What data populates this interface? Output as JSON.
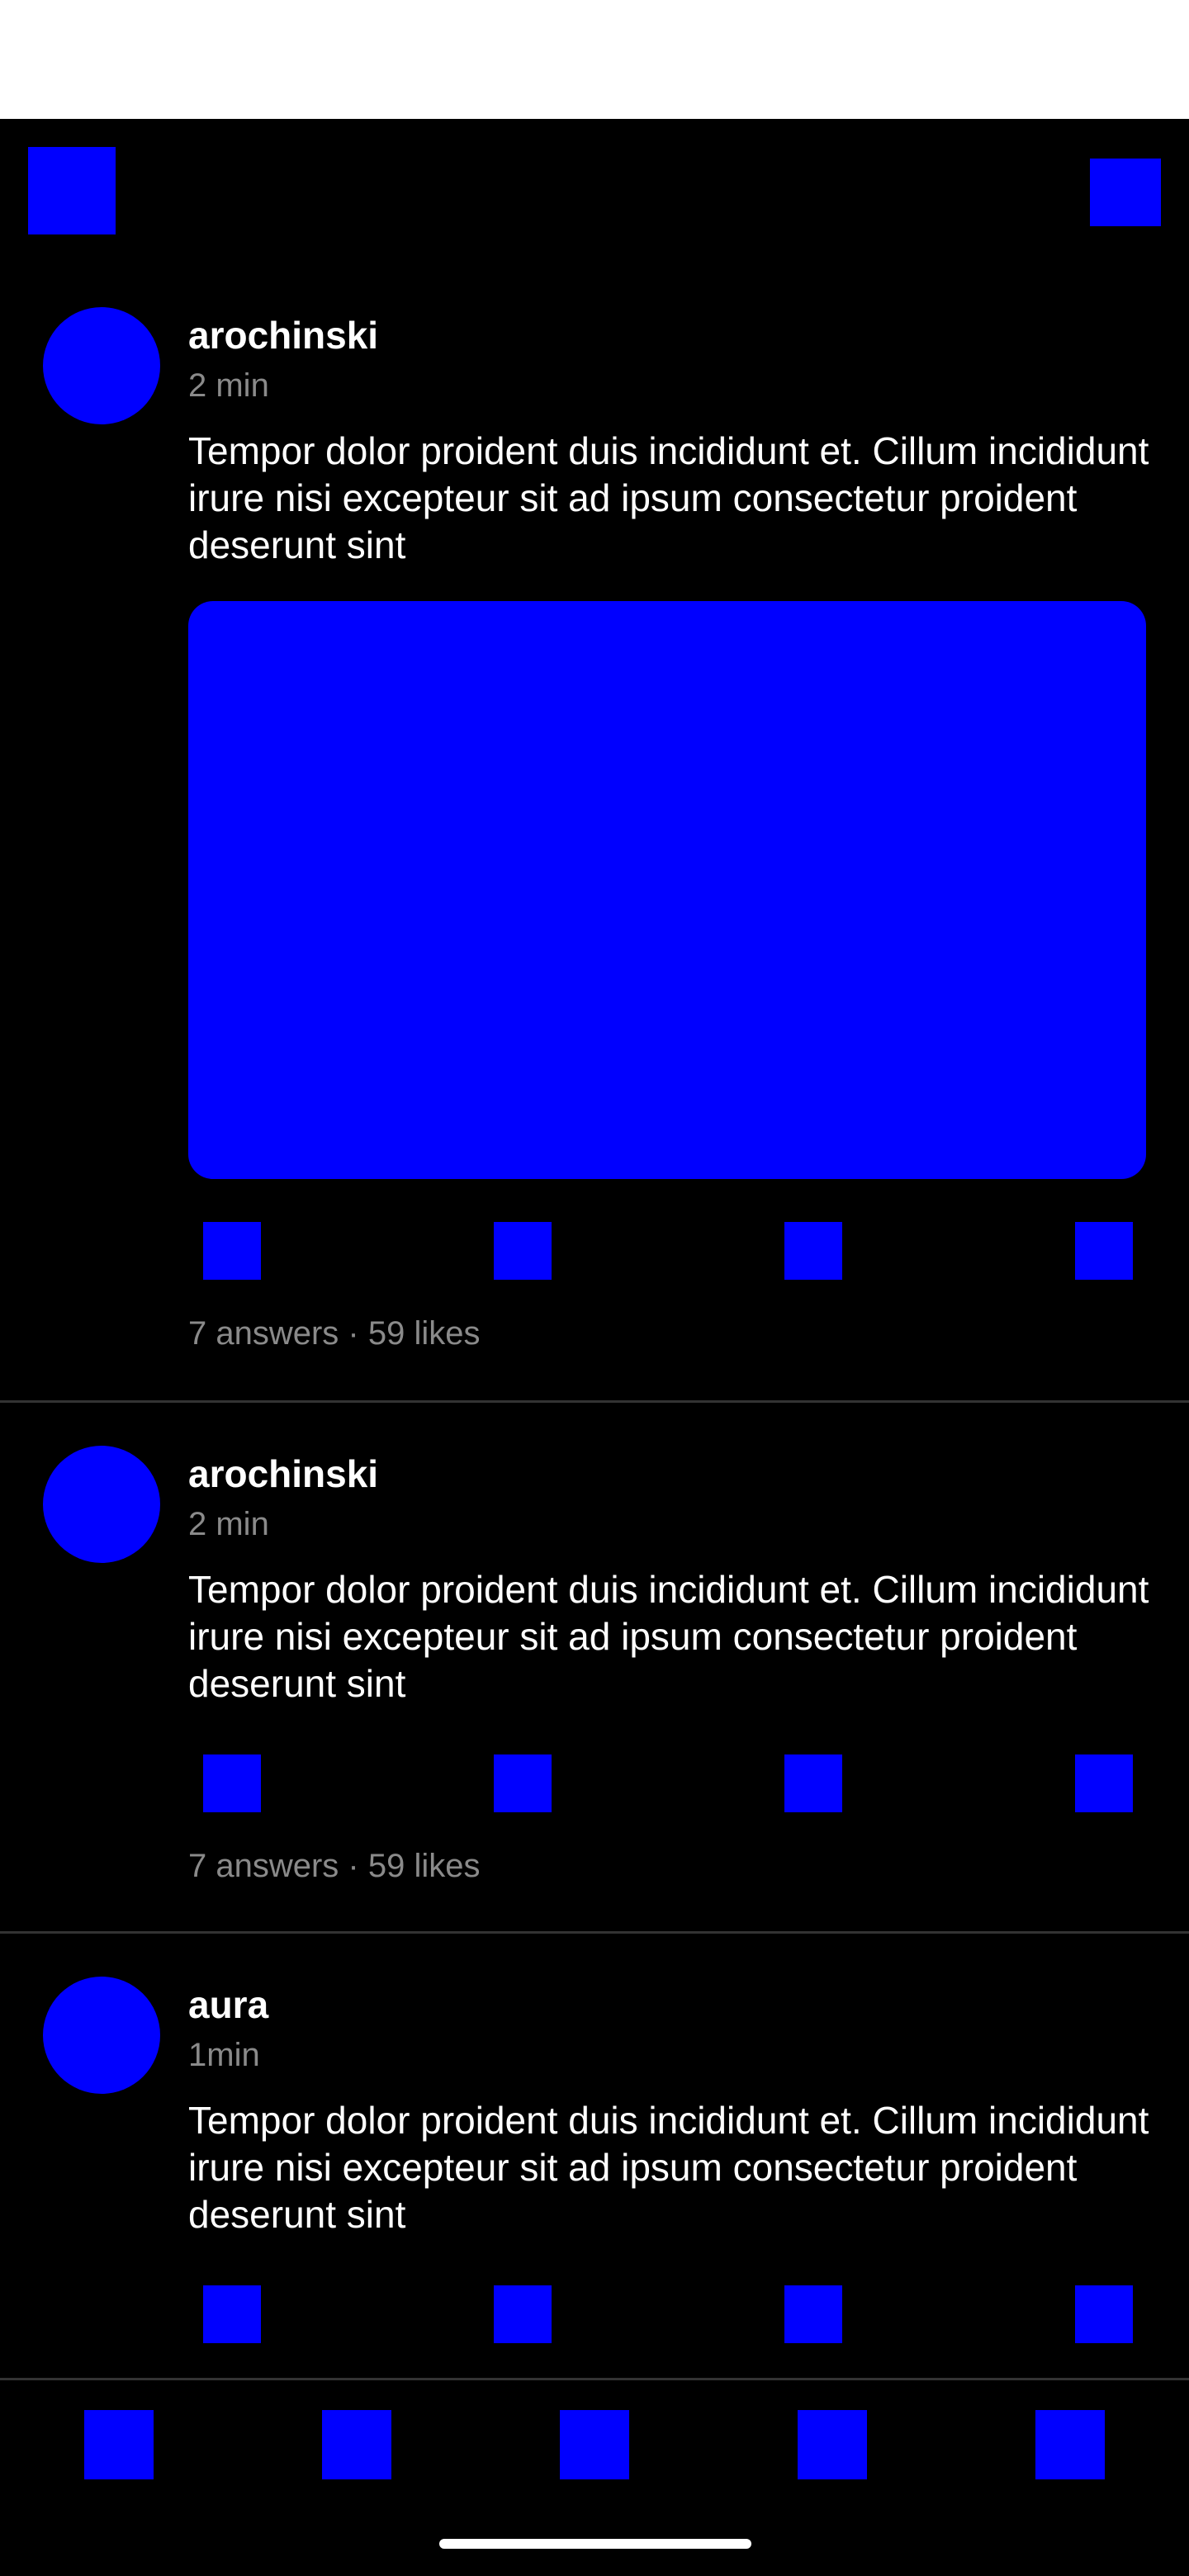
{
  "colors": {
    "accent": "#0000ff",
    "background": "#000000",
    "text_primary": "#ffffff",
    "text_secondary": "#8a8a8a",
    "divider": "#333333"
  },
  "top_bar": {
    "left_icon": "menu-icon",
    "right_icon": "compose-icon"
  },
  "posts": [
    {
      "username": "arochinski",
      "time": "2 min",
      "text": "Tempor dolor proident duis incididunt et. Cillum incididunt irure nisi excepteur sit ad ipsum consectetur proident deserunt sint",
      "stats": "7 answers · 59 likes"
    },
    {
      "username": "arochinski",
      "time": "2 min",
      "text": "Tempor dolor proident duis incididunt et. Cillum incididunt irure nisi excepteur sit ad ipsum consectetur proident deserunt sint",
      "stats": "7 answers · 59 likes"
    },
    {
      "username": "aura",
      "time": "1min",
      "text": "Tempor dolor proident duis incididunt et. Cillum incididunt irure nisi excepteur sit ad ipsum consectetur proident deserunt sint"
    }
  ],
  "post_actions": [
    "like-icon",
    "comment-icon",
    "repost-icon",
    "share-icon"
  ],
  "bottom_nav": [
    "home-icon",
    "search-icon",
    "new-post-icon",
    "activity-icon",
    "profile-icon"
  ]
}
